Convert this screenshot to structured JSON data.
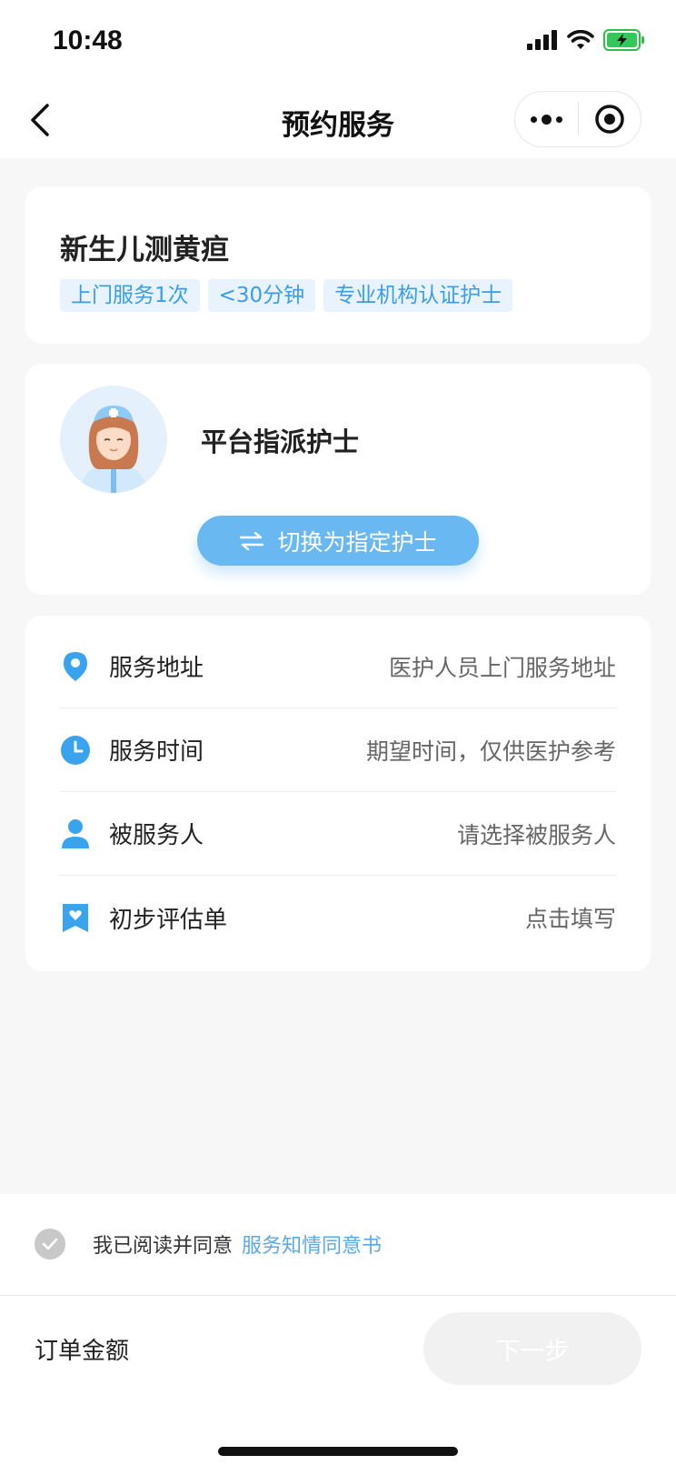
{
  "status_bar": {
    "time": "10:48"
  },
  "nav": {
    "title": "预约服务"
  },
  "service": {
    "name": "新生儿测黄疸",
    "tags": [
      "上门服务1次",
      "<30分钟",
      "专业机构认证护士"
    ]
  },
  "nurse": {
    "title": "平台指派护士",
    "switch_label": "切换为指定护士"
  },
  "info_rows": [
    {
      "label": "服务地址",
      "value": "医护人员上门服务地址",
      "icon": "location-pin-icon",
      "color": "#3aa3ee"
    },
    {
      "label": "服务时间",
      "value": "期望时间，仅供医护参考",
      "icon": "clock-icon",
      "color": "#3aa3ee"
    },
    {
      "label": "被服务人",
      "value": "请选择被服务人",
      "icon": "person-icon",
      "color": "#3aa3ee"
    },
    {
      "label": "初步评估单",
      "value": "点击填写",
      "icon": "assessment-form-icon",
      "color": "#3aa3ee"
    }
  ],
  "agreement": {
    "text": "我已阅读并同意",
    "link": "服务知情同意书"
  },
  "footer": {
    "order_amount_label": "订单金额",
    "next_label": "下一步"
  },
  "colors": {
    "accent": "#3aa3ee",
    "button": "#6ab8f2",
    "tag_bg": "#e8f3fd",
    "tag_text": "#3a9de8"
  }
}
